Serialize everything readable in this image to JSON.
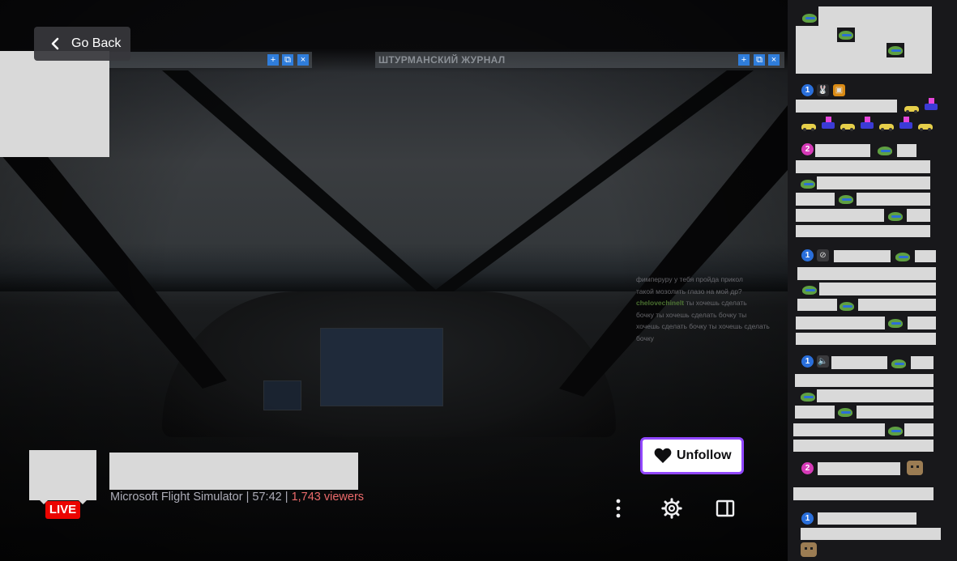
{
  "nav": {
    "go_back_label": "Go Back"
  },
  "video": {
    "overlay_title": "ШТУРМАНСКИЙ ЖУРНАЛ",
    "chat_overlay_lines": [
      {
        "user": "",
        "text": "фимперуру у тебя пройда прикол"
      },
      {
        "user": "",
        "text": "такой мозолить глазо на мой др?"
      },
      {
        "user": "chelovechinelt",
        "text": "ты хочешь сделать"
      },
      {
        "user": "",
        "text": "бочку ты хочешь сделать бочку ты"
      },
      {
        "user": "",
        "text": "хочешь сделать бочку ты хочешь сделать"
      },
      {
        "user": "",
        "text": "бочку"
      }
    ]
  },
  "stream": {
    "live_label": "LIVE",
    "category": "Microsoft Flight Simulator",
    "uptime": "57:42",
    "viewers": "1,743 viewers",
    "separator": "|"
  },
  "actions": {
    "unfollow_label": "Unfollow"
  },
  "chat": {
    "badges": [
      "1",
      "2",
      "1",
      "1",
      "2",
      "1"
    ]
  },
  "colors": {
    "accent": "#9147ff",
    "live": "#eb0400",
    "viewers": "#eb6a6a",
    "background": "#0e0e10",
    "chat_bg": "#18181b"
  },
  "icons": [
    "chevron-left-icon",
    "heart-icon",
    "more-vertical-icon",
    "gear-icon",
    "theatre-mode-icon",
    "plus-icon",
    "popout-icon",
    "close-icon"
  ]
}
